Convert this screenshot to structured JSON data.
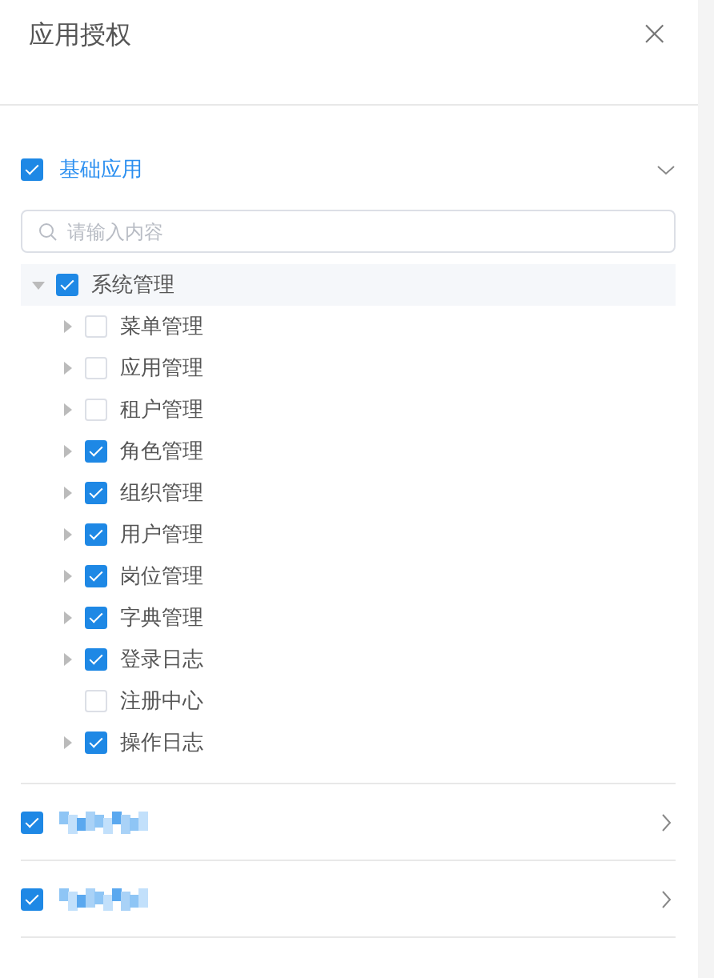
{
  "dialog": {
    "title": "应用授权",
    "close": "×"
  },
  "groups": [
    {
      "label": "基础应用",
      "checked": true,
      "expanded": true,
      "search": {
        "placeholder": "请输入内容"
      },
      "tree": [
        {
          "label": "系统管理",
          "checked": true,
          "expanded": true,
          "selected": true,
          "children": [
            {
              "label": "菜单管理",
              "checked": false,
              "has_children": true
            },
            {
              "label": "应用管理",
              "checked": false,
              "has_children": true
            },
            {
              "label": "租户管理",
              "checked": false,
              "has_children": true
            },
            {
              "label": "角色管理",
              "checked": true,
              "has_children": true
            },
            {
              "label": "组织管理",
              "checked": true,
              "has_children": true
            },
            {
              "label": "用户管理",
              "checked": true,
              "has_children": true
            },
            {
              "label": "岗位管理",
              "checked": true,
              "has_children": true
            },
            {
              "label": "字典管理",
              "checked": true,
              "has_children": true
            },
            {
              "label": "登录日志",
              "checked": true,
              "has_children": true
            },
            {
              "label": "注册中心",
              "checked": false,
              "has_children": false
            },
            {
              "label": "操作日志",
              "checked": true,
              "has_children": true
            }
          ]
        }
      ]
    },
    {
      "checked": true,
      "expanded": false,
      "redacted": true
    },
    {
      "checked": true,
      "expanded": false,
      "redacted": true
    }
  ]
}
